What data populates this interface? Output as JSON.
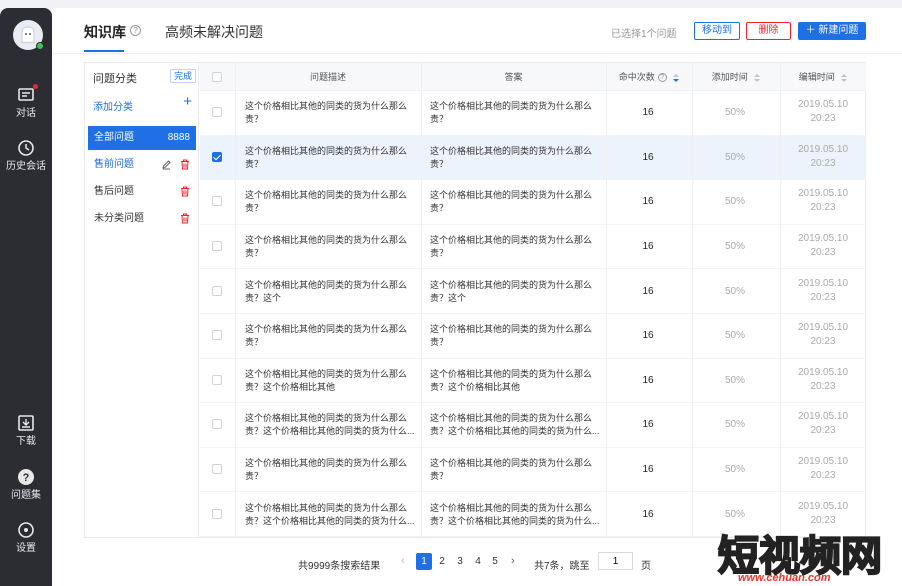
{
  "sidebar": {
    "nav": [
      {
        "label": "对话",
        "icon": "chat-icon"
      },
      {
        "label": "历史会话",
        "icon": "clock-icon"
      },
      {
        "label": "下载",
        "icon": "download-icon"
      },
      {
        "label": "问题集",
        "icon": "question-icon"
      },
      {
        "label": "设置",
        "icon": "settings-icon"
      }
    ]
  },
  "header": {
    "tab_active": "知识库",
    "tab_other": "高频未解决问题",
    "selected_info": "已选择1个问题",
    "move_label": "移动到",
    "delete_label": "删除",
    "new_label": "新建问题"
  },
  "categories": {
    "title": "问题分类",
    "done_label": "完成",
    "add_label": "添加分类",
    "items": [
      {
        "label": "全部问题",
        "count": "8888"
      },
      {
        "label": "售前问题"
      },
      {
        "label": "售后问题"
      },
      {
        "label": "未分类问题"
      }
    ]
  },
  "table": {
    "headers": {
      "question": "问题描述",
      "answer": "答案",
      "hits": "命中次数",
      "added": "添加时间",
      "edited": "编辑时间"
    },
    "rows": [
      {
        "q": "这个价格相比其他的同类的货为什么那么贵？",
        "a": "这个价格相比其他的同类的货为什么那么贵？",
        "hits": "16",
        "rate": "50%",
        "date": "2019.05.10",
        "time": "20:23",
        "checked": false
      },
      {
        "q": "这个价格相比其他的同类的货为什么那么贵？",
        "a": "这个价格相比其他的同类的货为什么那么贵？",
        "hits": "16",
        "rate": "50%",
        "date": "2019.05.10",
        "time": "20:23",
        "checked": true
      },
      {
        "q": "这个价格相比其他的同类的货为什么那么贵？",
        "a": "这个价格相比其他的同类的货为什么那么贵？",
        "hits": "16",
        "rate": "50%",
        "date": "2019.05.10",
        "time": "20:23",
        "checked": false
      },
      {
        "q": "这个价格相比其他的同类的货为什么那么贵？",
        "a": "这个价格相比其他的同类的货为什么那么贵？",
        "hits": "16",
        "rate": "50%",
        "date": "2019.05.10",
        "time": "20:23",
        "checked": false
      },
      {
        "q": "这个价格相比其他的同类的货为什么那么贵？这个",
        "a": "这个价格相比其他的同类的货为什么那么贵？这个",
        "hits": "16",
        "rate": "50%",
        "date": "2019.05.10",
        "time": "20:23",
        "checked": false
      },
      {
        "q": "这个价格相比其他的同类的货为什么那么贵？",
        "a": "这个价格相比其他的同类的货为什么那么贵？",
        "hits": "16",
        "rate": "50%",
        "date": "2019.05.10",
        "time": "20:23",
        "checked": false
      },
      {
        "q": "这个价格相比其他的同类的货为什么那么贵？这个价格相比其他",
        "a": "这个价格相比其他的同类的货为什么那么贵？这个价格相比其他",
        "hits": "16",
        "rate": "50%",
        "date": "2019.05.10",
        "time": "20:23",
        "checked": false
      },
      {
        "q": "这个价格相比其他的同类的货为什么那么贵？这个价格相比其他的同类的货为什么...",
        "a": "这个价格相比其他的同类的货为什么那么贵？这个价格相比其他的同类的货为什么...",
        "hits": "16",
        "rate": "50%",
        "date": "2019.05.10",
        "time": "20:23",
        "checked": false
      },
      {
        "q": "这个价格相比其他的同类的货为什么那么贵？",
        "a": "这个价格相比其他的同类的货为什么那么贵？",
        "hits": "16",
        "rate": "50%",
        "date": "2019.05.10",
        "time": "20:23",
        "checked": false
      },
      {
        "q": "这个价格相比其他的同类的货为什么那么贵？这个价格相比其他的同类的货为什么...",
        "a": "这个价格相比其他的同类的货为什么那么贵？这个价格相比其他的同类的货为什么...",
        "hits": "16",
        "rate": "50%",
        "date": "2019.05.10",
        "time": "20:23",
        "checked": false
      }
    ]
  },
  "pagination": {
    "total": "共9999条搜索结果",
    "pages": [
      "1",
      "2",
      "3",
      "4",
      "5"
    ],
    "current": "1",
    "info": "共7条，跳至",
    "jump_value": "1",
    "page_suffix": "页"
  },
  "watermark": {
    "title": "短视频网",
    "url": "www.cehuan.com"
  },
  "colors": {
    "accent": "#1f6fe5",
    "danger": "#f5222d",
    "sidebar": "#2b2d33"
  }
}
